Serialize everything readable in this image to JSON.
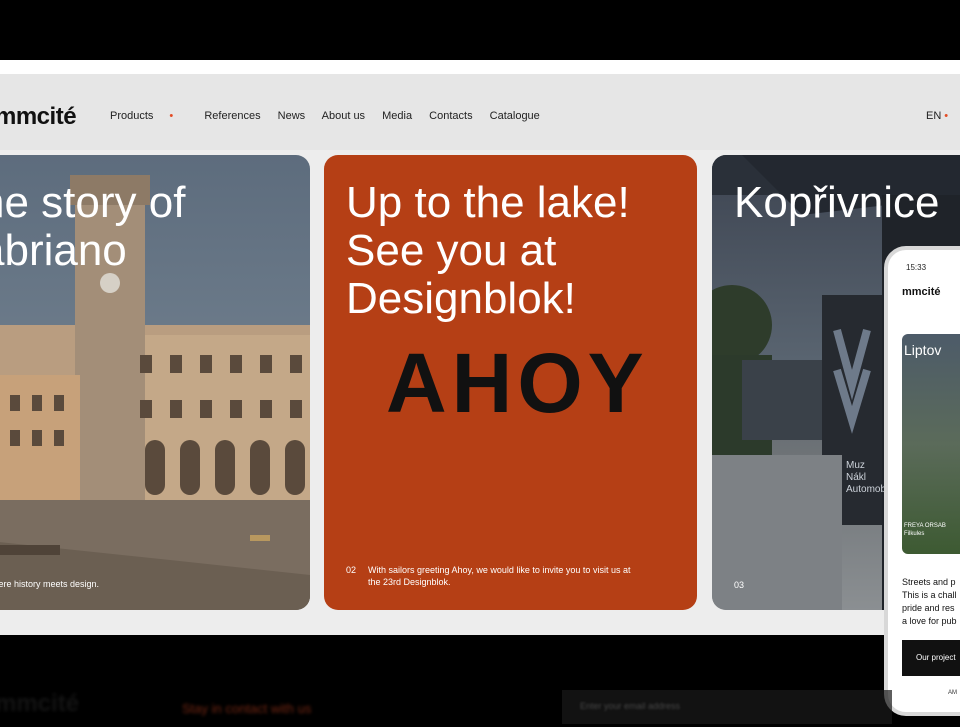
{
  "brand": {
    "logo": "mmcité",
    "accent": "#e34c25"
  },
  "nav": {
    "products": "Products",
    "references": "References",
    "news": "News",
    "about": "About us",
    "media": "Media",
    "contacts": "Contacts",
    "catalogue": "Catalogue",
    "lang": "EN"
  },
  "cards": [
    {
      "title": "he story of\nabriano",
      "caption": "y where history meets design."
    },
    {
      "title": "Up to the lake!\nSee you at\nDesignblok!",
      "big_text": "AHOY",
      "number": "02",
      "caption": "With sailors greeting Ahoy, we would like to invite you to visit us at\nthe 23rd Designblok.",
      "color": "#b53f15"
    },
    {
      "title": "Kopřivnice",
      "number": "03",
      "sign_text": "Muz\nNákl\nAutomob"
    }
  ],
  "phone": {
    "time": "15:33",
    "logo": "mmcité",
    "card_title": "Liptov",
    "card_caption": "FREYA ORSAB\nFilkules",
    "text": "Streets and p\nThis is a chall\npride and res\na love for pub",
    "button": "Our project",
    "footer": "AM"
  },
  "footer": {
    "logo": "mmcité",
    "link": "Stay in contact with us",
    "input_placeholder": "Enter your email address"
  }
}
